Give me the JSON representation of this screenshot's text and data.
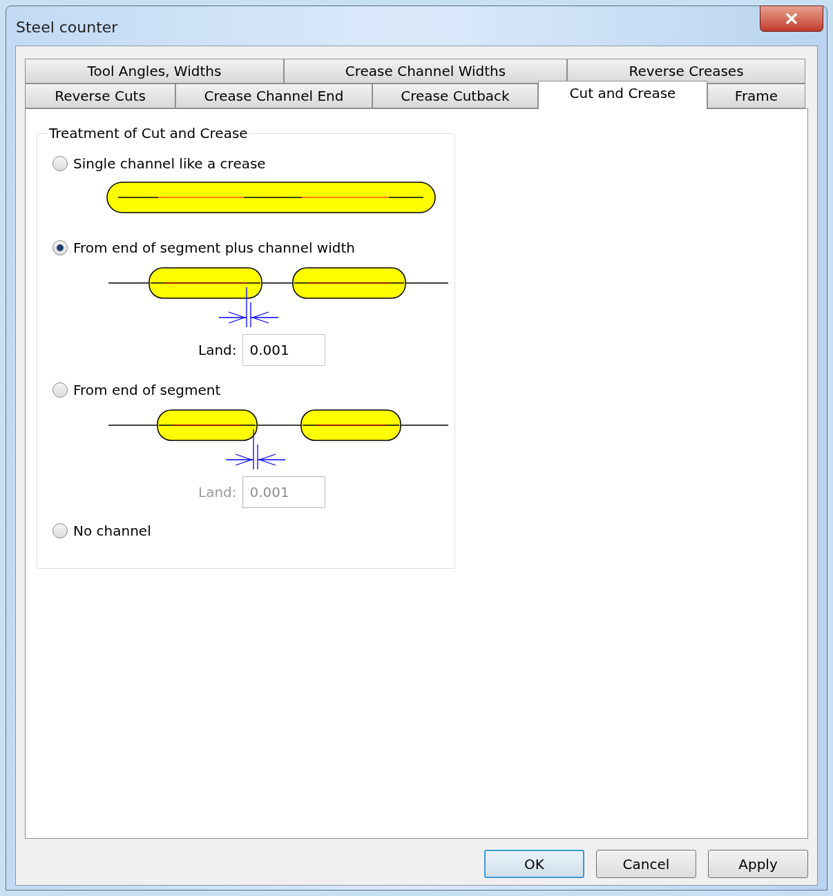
{
  "window": {
    "title": "Steel counter"
  },
  "tab_rows": [
    [
      {
        "label": "Tool Angles, Widths",
        "selected": false
      },
      {
        "label": "Crease Channel Widths",
        "selected": false
      },
      {
        "label": "Reverse Creases",
        "selected": false
      }
    ],
    [
      {
        "label": "Reverse Cuts",
        "selected": false
      },
      {
        "label": "Crease Channel End",
        "selected": false
      },
      {
        "label": "Crease Cutback",
        "selected": false
      },
      {
        "label": "Cut and Crease",
        "selected": true
      },
      {
        "label": "Frame",
        "selected": false
      }
    ]
  ],
  "group": {
    "title": "Treatment of Cut and Crease",
    "options": [
      {
        "label": "Single channel like a crease",
        "selected": false,
        "kind": "single"
      },
      {
        "label": "From end of segment plus channel width",
        "selected": true,
        "kind": "channel-width",
        "land": {
          "label": "Land:",
          "value": "0.001",
          "disabled": false
        }
      },
      {
        "label": "From end of segment",
        "selected": false,
        "kind": "segment-end",
        "land": {
          "label": "Land:",
          "value": "0.001",
          "disabled": true
        }
      },
      {
        "label": "No channel",
        "selected": false,
        "kind": "plain"
      }
    ]
  },
  "buttons": [
    {
      "label": "OK",
      "default": true
    },
    {
      "label": "Cancel",
      "default": false
    },
    {
      "label": "Apply",
      "default": false
    }
  ]
}
